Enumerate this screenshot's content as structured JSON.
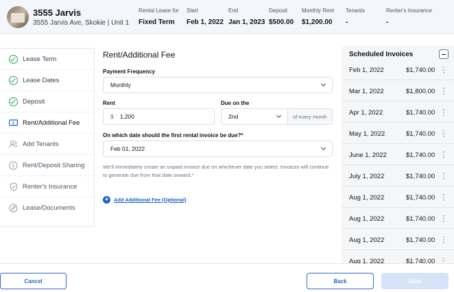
{
  "property": {
    "name": "3555 Jarvis",
    "address": "3555 Jarvis Ave, Skokie | Unit 1"
  },
  "summary": [
    {
      "label": "Rental Lease for",
      "value": "Fixed Term"
    },
    {
      "label": "Start",
      "value": "Feb 1, 2022"
    },
    {
      "label": "End",
      "value": "Jan 1, 2023"
    },
    {
      "label": "Deposit",
      "value": "$500.00"
    },
    {
      "label": "Monthly Rent",
      "value": "$1,200.00"
    },
    {
      "label": "Tenants",
      "value": "-"
    },
    {
      "label": "Renter's Insurance",
      "value": "-"
    }
  ],
  "sidebar": {
    "items": [
      {
        "label": "Lease Term",
        "icon": "check-circle-icon",
        "state": "done"
      },
      {
        "label": "Lease Dates",
        "icon": "check-circle-icon",
        "state": "done"
      },
      {
        "label": "Deposit",
        "icon": "check-circle-icon",
        "state": "done"
      },
      {
        "label": "Rent/Additional Fee",
        "icon": "rent-icon",
        "state": "active"
      },
      {
        "label": "Add Tenants",
        "icon": "users-icon",
        "state": "todo"
      },
      {
        "label": "Rent/Deposit Sharing",
        "icon": "dollar-icon",
        "state": "todo"
      },
      {
        "label": "Renter's Insurance",
        "icon": "shield-icon",
        "state": "todo"
      },
      {
        "label": "Lease/Documents",
        "icon": "document-icon",
        "state": "todo"
      }
    ]
  },
  "form": {
    "title": "Rent/Additional Fee",
    "payment_frequency_label": "Payment Frequency",
    "payment_frequency_value": "Monthly",
    "rent_label": "Rent",
    "rent_prefix": "$",
    "rent_value": "1,200",
    "due_label": "Due on the",
    "due_value": "2nd",
    "due_suffix": "of every month",
    "first_invoice_label": "On which date should the first rental invoice be due?*",
    "first_invoice_value": "Feb 01, 2022",
    "hint": "We'll immediately create an unpaid invoice due on whichever date you select. Invoices will continue to generate due from that date onward.*",
    "add_fee_label": "Add Additional Fee (Optional)"
  },
  "invoices": {
    "title": "Scheduled Invoices",
    "rows": [
      {
        "date": "Feb 1, 2022",
        "amount": "$1,740.00"
      },
      {
        "date": "Mar 1, 2022",
        "amount": "$1,800.00"
      },
      {
        "date": "Apr 1, 2022",
        "amount": "$1,740.00"
      },
      {
        "date": "May 1, 2022",
        "amount": "$1,740.00"
      },
      {
        "date": "June 1, 2022",
        "amount": "$1,740.00"
      },
      {
        "date": "July 1, 2022",
        "amount": "$1,740.00"
      },
      {
        "date": "Aug 1, 2022",
        "amount": "$1,740.00"
      },
      {
        "date": "Aug 1, 2022",
        "amount": "$1,740.00"
      },
      {
        "date": "Aug 1, 2022",
        "amount": "$1,740.00"
      },
      {
        "date": "Aug 1, 2022",
        "amount": "$1,740.00"
      }
    ]
  },
  "footer": {
    "cancel_label": "Cancel",
    "back_label": "Back",
    "next_label": "Next"
  },
  "colors": {
    "accent": "#1d5fc7",
    "success": "#22a55b",
    "header_bg": "#f3f6fb",
    "disabled_button": "#d6e4fa"
  }
}
